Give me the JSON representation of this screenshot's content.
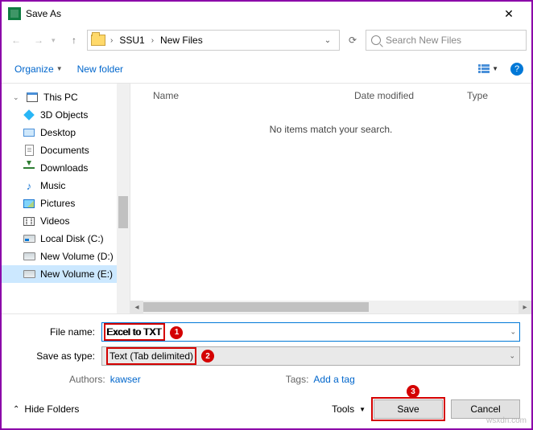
{
  "title": "Save As",
  "path": {
    "seg1": "SSU1",
    "seg2": "New Files"
  },
  "search": {
    "placeholder": "Search New Files"
  },
  "toolbar": {
    "organize": "Organize",
    "new_folder": "New folder"
  },
  "columns": {
    "name": "Name",
    "date": "Date modified",
    "type": "Type"
  },
  "empty_msg": "No items match your search.",
  "tree": {
    "root": "This PC",
    "items": [
      "3D Objects",
      "Desktop",
      "Documents",
      "Downloads",
      "Music",
      "Pictures",
      "Videos",
      "Local Disk (C:)",
      "New Volume (D:)",
      "New Volume (E:)"
    ]
  },
  "filename_label": "File name:",
  "filename_value": "Excel to TXT",
  "saveastype_label": "Save as type:",
  "saveastype_value": "Text (Tab delimited)",
  "authors_label": "Authors:",
  "authors_value": "kawser",
  "tags_label": "Tags:",
  "tags_value": "Add a tag",
  "hide_folders": "Hide Folders",
  "tools": "Tools",
  "save": "Save",
  "cancel": "Cancel",
  "badges": {
    "b1": "1",
    "b2": "2",
    "b3": "3"
  },
  "watermark": "wsxdn.com"
}
